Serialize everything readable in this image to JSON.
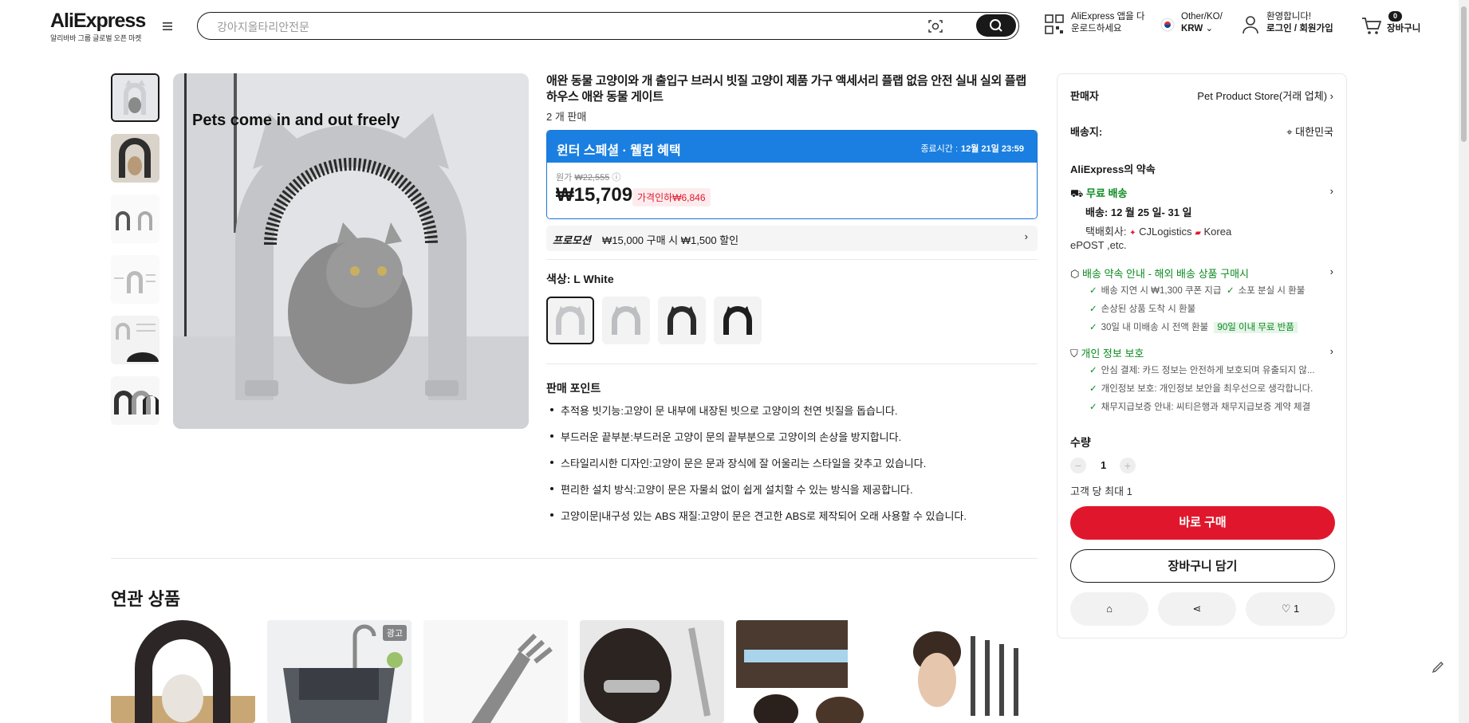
{
  "header": {
    "logo": "AliExpress",
    "logo_sub": "알리바바 그룹 글로벌 오픈 마켓",
    "search_placeholder": "강아지올타리안전문",
    "app_line1": "AliExpress 앱을 다",
    "app_line2": "운로드하세요",
    "locale_line1": "Other/KO/",
    "locale_currency": "KRW",
    "account_line1": "환영합니다!",
    "account_line2": "로그인 / 회원가입",
    "cart_count": "0",
    "cart_label": "장바구니"
  },
  "product": {
    "image_caption": "Pets come in and out freely",
    "title": "애완 동물 고양이와 개 출입구 브러시 빗질 고양이 제품 가구 액세서리 플랩 없음 안전 실내 실외 플랩 하우스 애완 동물 게이트",
    "sold": "2 개 판매",
    "promo_title": "윈터 스페셜 · 웰컴 혜택",
    "promo_end_label": "종료시간 :",
    "promo_end_time": "12월 21일 23:59",
    "orig_label": "원가",
    "orig_price": "₩22,555",
    "price": "₩15,709",
    "discount": "가격인하₩6,846",
    "promotion_label": "프로모션",
    "promotion_text": "₩15,000 구매 시 ₩1,500 할인",
    "color_label": "색상: L White",
    "points_title": "판매 포인트",
    "points": [
      "추적용 빗기능:고양이 문 내부에 내장된 빗으로 고양이의 천연 빗질을 돕습니다.",
      "부드러운 끝부분:부드러운 고양이 문의 끝부분으로 고양이의 손상을 방지합니다.",
      "스타일리시한 디자인:고양이 문은 문과 장식에 잘 어울리는 스타일을 갖추고 있습니다.",
      "편리한 설치 방식:고양이 문은 자물쇠 없이 쉽게 설치할 수 있는 방식을 제공합니다.",
      "고양이문|내구성 있는 ABS 재질:고양이 문은 견고한 ABS로 제작되어 오래 사용할 수 있습니다."
    ]
  },
  "side": {
    "seller_label": "판매자",
    "seller_name": "Pet Product Store(거래 업체)",
    "ship_to_label": "배송지:",
    "ship_to": "대한민국",
    "promise_title": "AliExpress의 약속",
    "free_ship": "무료 배송",
    "delivery": "배송: 12 월 25 일- 31 일",
    "courier_label": "택배회사:",
    "courier1": "CJLogistics",
    "courier2": "Korea",
    "courier3": "ePOST ,etc.",
    "guarantee_title": "배송 약속 안내 - 해외 배송 상품 구매시",
    "g1": "배송 지연 시 ₩1,300 쿠폰 지급",
    "g2": "소포 분실 시 환불",
    "g3": "손상된 상품 도착 시 환불",
    "g4": "30일 내 미배송 시 전액 환불",
    "g4_badge": "90일 이내 무료 반품",
    "privacy_title": "개인 정보 보호",
    "p1": "안심 결제: 카드 정보는 안전하게 보호되며 유출되지 않...",
    "p2": "개인정보 보호: 개인정보 보안을 최우선으로 생각합니다.",
    "p3": "채무지급보증 안내: 씨티은행과 채무지급보증 계약 체결",
    "qty_label": "수량",
    "qty": "1",
    "qty_limit": "고객 당 최대 1",
    "buy_now": "바로 구매",
    "add_cart": "장바구니 담기",
    "wish_count": "1"
  },
  "related": {
    "title": "연관 상품",
    "ad_badge": "광고"
  }
}
